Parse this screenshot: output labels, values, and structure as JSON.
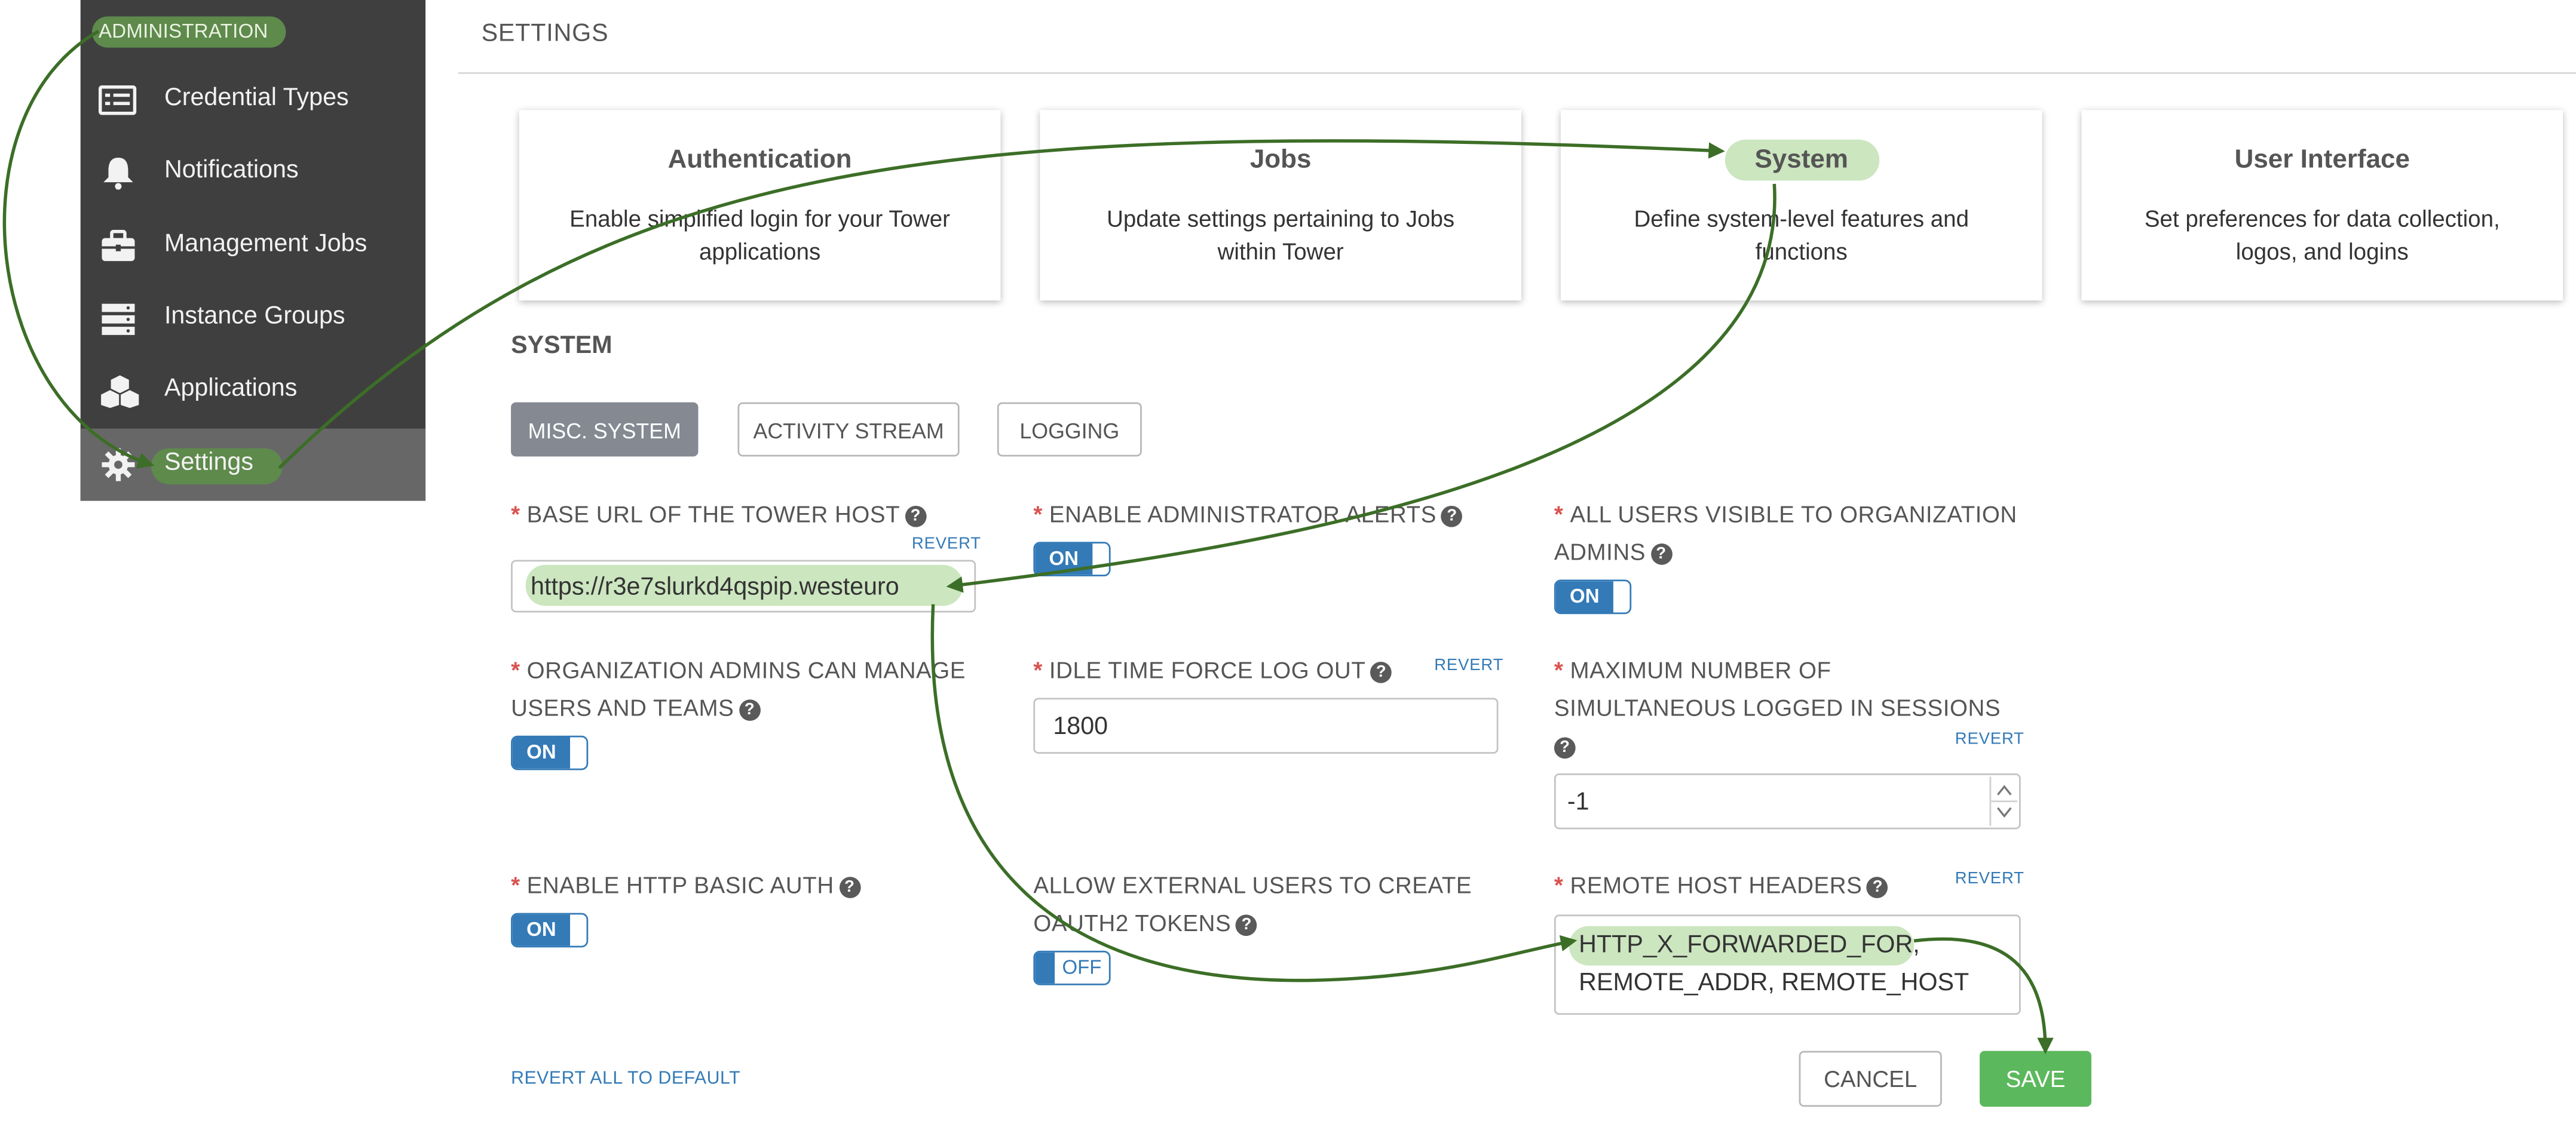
{
  "sidebar": {
    "section": "ADMINISTRATION",
    "items": [
      {
        "label": "Credential Types",
        "icon": "list-card-icon"
      },
      {
        "label": "Notifications",
        "icon": "bell-icon"
      },
      {
        "label": "Management Jobs",
        "icon": "briefcase-icon"
      },
      {
        "label": "Instance Groups",
        "icon": "server-stack-icon"
      },
      {
        "label": "Applications",
        "icon": "cubes-icon"
      },
      {
        "label": "Settings",
        "icon": "gear-icon",
        "active": true
      }
    ]
  },
  "header": {
    "title": "SETTINGS"
  },
  "cards": [
    {
      "title": "Authentication",
      "desc": "Enable simplified login for your Tower applications"
    },
    {
      "title": "Jobs",
      "desc": "Update settings pertaining to Jobs within Tower"
    },
    {
      "title": "System",
      "desc": "Define system-level features and functions",
      "highlighted": true
    },
    {
      "title": "User Interface",
      "desc": "Set preferences for data collection, logos, and logins"
    }
  ],
  "section": {
    "title": "SYSTEM",
    "tabs": [
      {
        "label": "MISC. SYSTEM",
        "active": true
      },
      {
        "label": "ACTIVITY STREAM"
      },
      {
        "label": "LOGGING"
      }
    ]
  },
  "fields": {
    "base_url": {
      "label": "BASE URL OF THE TOWER HOST",
      "revert": "REVERT",
      "value": "https://r3e7slurkd4qspip.westeuro"
    },
    "admin_alerts": {
      "label": "ENABLE ADMINISTRATOR ALERTS",
      "state": "ON"
    },
    "all_users_visible": {
      "label_line1": "ALL USERS VISIBLE TO ORGANIZATION",
      "label_line2": "ADMINS",
      "state": "ON"
    },
    "org_admins_manage": {
      "label_line1": "ORGANIZATION ADMINS CAN MANAGE",
      "label_line2": "USERS AND TEAMS",
      "state": "ON"
    },
    "idle_timeout": {
      "label": "IDLE TIME FORCE LOG OUT",
      "revert": "REVERT",
      "value": "1800"
    },
    "max_sessions": {
      "label_line1": "MAXIMUM NUMBER OF",
      "label_line2": "SIMULTANEOUS LOGGED IN SESSIONS",
      "revert": "REVERT",
      "value": "-1"
    },
    "http_basic_auth": {
      "label": "ENABLE HTTP BASIC AUTH",
      "state": "ON"
    },
    "oauth2_tokens": {
      "label_line1": "ALLOW EXTERNAL USERS TO CREATE",
      "label_line2": "OAUTH2 TOKENS",
      "state": "OFF"
    },
    "remote_host_headers": {
      "label": "REMOTE HOST HEADERS",
      "revert": "REVERT",
      "value_line1": "HTTP_X_FORWARDED_FOR,",
      "value_line2": "REMOTE_ADDR, REMOTE_HOST"
    }
  },
  "footer": {
    "revert_all": "REVERT ALL TO DEFAULT",
    "cancel": "CANCEL",
    "save": "SAVE"
  },
  "colors": {
    "sidebar_bg": "#3f3f3f",
    "highlight": "#cce6c0",
    "arrow": "#3c6e27",
    "toggle_blue": "#337ab7",
    "save_green": "#5cb85c"
  }
}
